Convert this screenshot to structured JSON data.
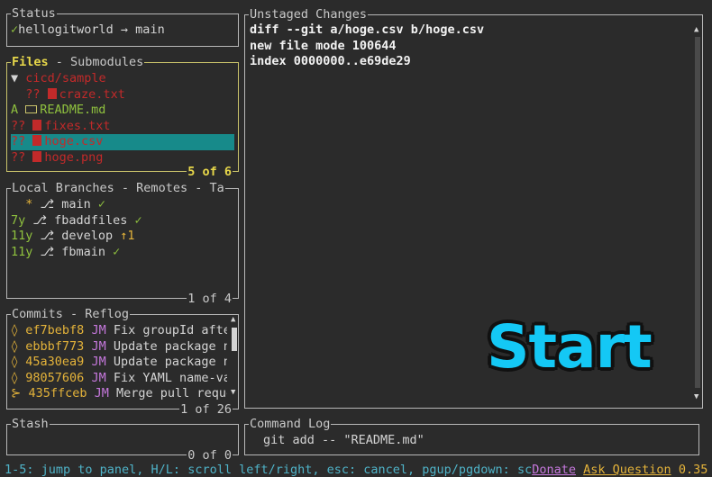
{
  "status": {
    "title": "Status",
    "check": "✓",
    "text": "hellogitworld → main"
  },
  "files": {
    "title_active": "Files",
    "title_sep": " - ",
    "title_other": "Submodules",
    "footer": "5 of 6",
    "rows": [
      {
        "prefix": "▼ ",
        "status": "",
        "name": "cicd/sample",
        "color": "red",
        "icon": "none"
      },
      {
        "prefix": "  ",
        "status": "??",
        "name": "craze.txt",
        "color": "red",
        "icon": "file"
      },
      {
        "prefix": "",
        "status": "A ",
        "name": "README.md",
        "color": "green",
        "icon": "md"
      },
      {
        "prefix": "",
        "status": "??",
        "name": "fixes.txt",
        "color": "red",
        "icon": "file"
      },
      {
        "prefix": "",
        "status": "??",
        "name": "hoge.csv",
        "color": "red",
        "icon": "file"
      },
      {
        "prefix": "",
        "status": "??",
        "name": "hoge.png",
        "color": "red",
        "icon": "file"
      }
    ]
  },
  "branches": {
    "title_active": "Local Branches",
    "title_rest": " - Remotes - Ta",
    "footer": "1 of 4",
    "rows": [
      {
        "age": "  *",
        "name": "main",
        "track": "✓",
        "track_color": "green"
      },
      {
        "age": "7y",
        "name": "fbaddfiles",
        "track": "✓",
        "track_color": "green"
      },
      {
        "age": "11y",
        "name": "develop",
        "track": "↑1",
        "track_color": "yellow"
      },
      {
        "age": "11y",
        "name": "fbmain",
        "track": "✓",
        "track_color": "green"
      }
    ]
  },
  "commits": {
    "title_active": "Commits",
    "title_rest": " - Reflog",
    "footer": "1 of 26",
    "rows": [
      {
        "glyph": "◊",
        "hash": "ef7bebf8",
        "author": "JM",
        "msg": "Fix groupId after"
      },
      {
        "glyph": "◊",
        "hash": "ebbbf773",
        "author": "JM",
        "msg": "Update package na"
      },
      {
        "glyph": "◊",
        "hash": "45a30ea9",
        "author": "JM",
        "msg": "Update package na"
      },
      {
        "glyph": "◊",
        "hash": "98057606",
        "author": "JM",
        "msg": "Fix YAML name-val"
      },
      {
        "glyph": "⊱",
        "hash": "435ffceb",
        "author": "JM",
        "msg": "Merge pull reques"
      }
    ]
  },
  "stash": {
    "title": "Stash",
    "footer": "0 of 0"
  },
  "unstaged": {
    "title": "Unstaged Changes",
    "lines": [
      "diff --git a/hoge.csv b/hoge.csv",
      "new file mode 100644",
      "index 0000000..e69de29"
    ]
  },
  "command_log": {
    "title": "Command Log",
    "entry": "git add -- \"README.md\""
  },
  "overlay": {
    "text": "Start"
  },
  "status_bar": {
    "help": "1-5: jump to panel, H/L: scroll left/right, esc: cancel, pgup/pgdown: sc",
    "donate": "Donate",
    "ask": "Ask Question",
    "version": "0.35"
  },
  "colors": {
    "selection": "#178a8a",
    "active_border": "#c9c26a",
    "start_text": "#14c8f5"
  }
}
